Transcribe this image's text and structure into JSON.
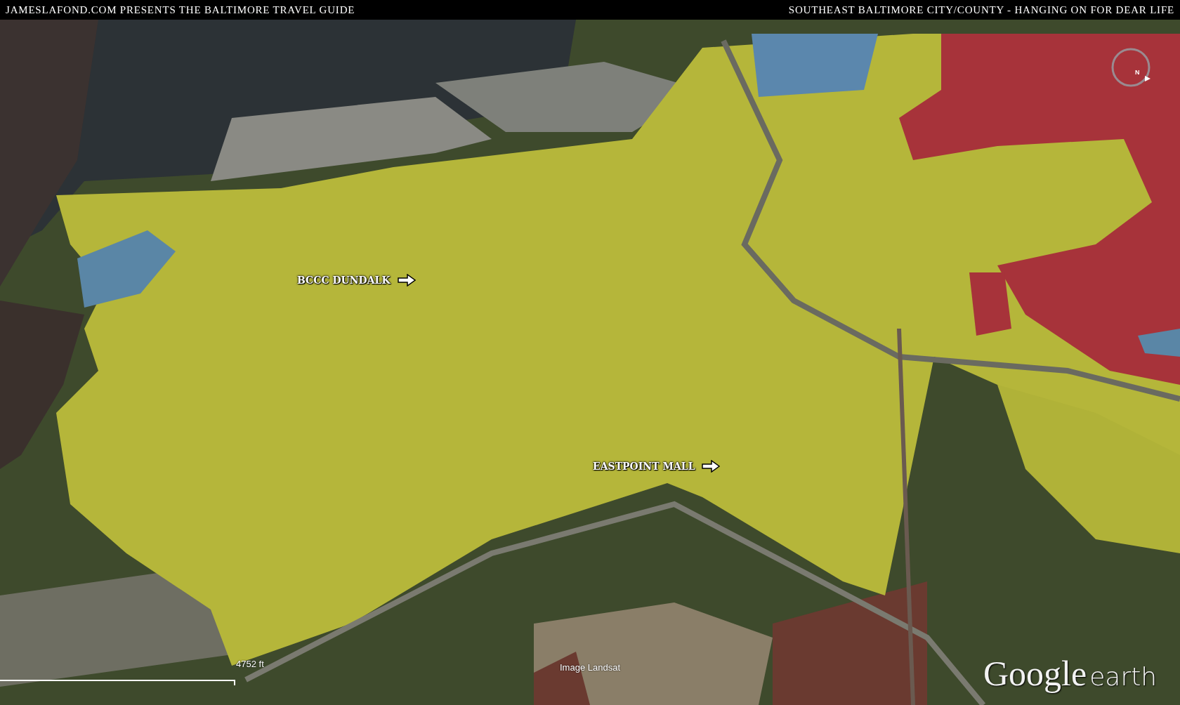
{
  "header": {
    "left": "JAMESLAFOND.COM PRESENTS THE BALTIMORE TRAVEL GUIDE",
    "right": "SOUTHEAST BALTIMORE CITY/COUNTY - HANGING ON FOR DEAR LIFE"
  },
  "labels": [
    {
      "text": "BCCC DUNDALK"
    },
    {
      "text": "EASTPOINT MALL"
    }
  ],
  "scale": "4752 ft",
  "attribution": "Image Landsat",
  "logo": {
    "google": "Google",
    "earth": "earth"
  },
  "compass": "N"
}
